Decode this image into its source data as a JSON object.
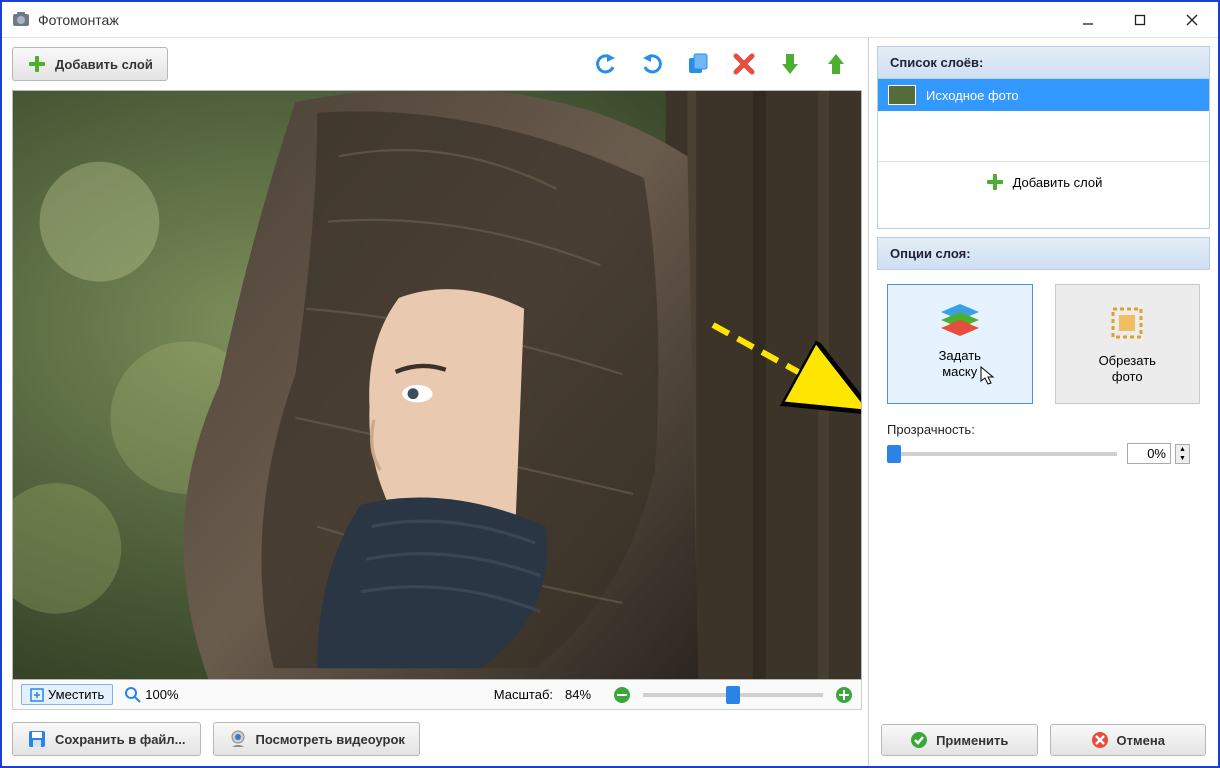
{
  "window": {
    "title": "Фотомонтаж"
  },
  "toolbar": {
    "add_layer": "Добавить слой"
  },
  "zoom": {
    "fit": "Уместить",
    "hundred": "100%",
    "label": "Масштаб:",
    "value": "84%"
  },
  "bottom": {
    "save": "Сохранить в файл...",
    "video": "Посмотреть видеоурок"
  },
  "right": {
    "layers_header": "Список слоёв:",
    "layers": [
      {
        "label": "Исходное фото"
      }
    ],
    "add_layer": "Добавить слой",
    "options_header": "Опции слоя:",
    "tiles": {
      "mask": "Задать\nмаску",
      "crop": "Обрезать\nфото"
    },
    "opacity_label": "Прозрачность:",
    "opacity_value": "0%"
  },
  "actions": {
    "apply": "Применить",
    "cancel": "Отмена"
  }
}
